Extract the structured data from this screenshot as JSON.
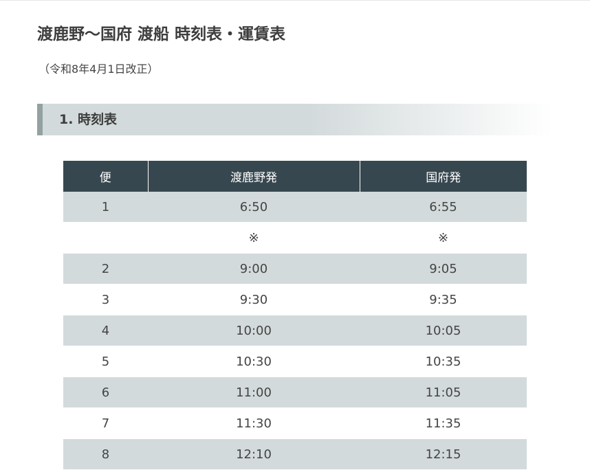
{
  "page": {
    "title": "渡鹿野〜国府 渡船 時刻表・運賃表",
    "revision": "（令和8年4月1日改正）"
  },
  "section1": {
    "heading": "1. 時刻表"
  },
  "timetable": {
    "headers": [
      "便",
      "渡鹿野発",
      "国府発"
    ],
    "rows": [
      {
        "trip": "1",
        "from_watakano": "6:50",
        "from_kou": "6:55"
      },
      {
        "trip": "",
        "from_watakano": "※",
        "from_kou": "※"
      },
      {
        "trip": "2",
        "from_watakano": "9:00",
        "from_kou": "9:05"
      },
      {
        "trip": "3",
        "from_watakano": "9:30",
        "from_kou": "9:35"
      },
      {
        "trip": "4",
        "from_watakano": "10:00",
        "from_kou": "10:05"
      },
      {
        "trip": "5",
        "from_watakano": "10:30",
        "from_kou": "10:35"
      },
      {
        "trip": "6",
        "from_watakano": "11:00",
        "from_kou": "11:05"
      },
      {
        "trip": "7",
        "from_watakano": "11:30",
        "from_kou": "11:35"
      },
      {
        "trip": "8",
        "from_watakano": "12:10",
        "from_kou": "12:15"
      }
    ]
  }
}
